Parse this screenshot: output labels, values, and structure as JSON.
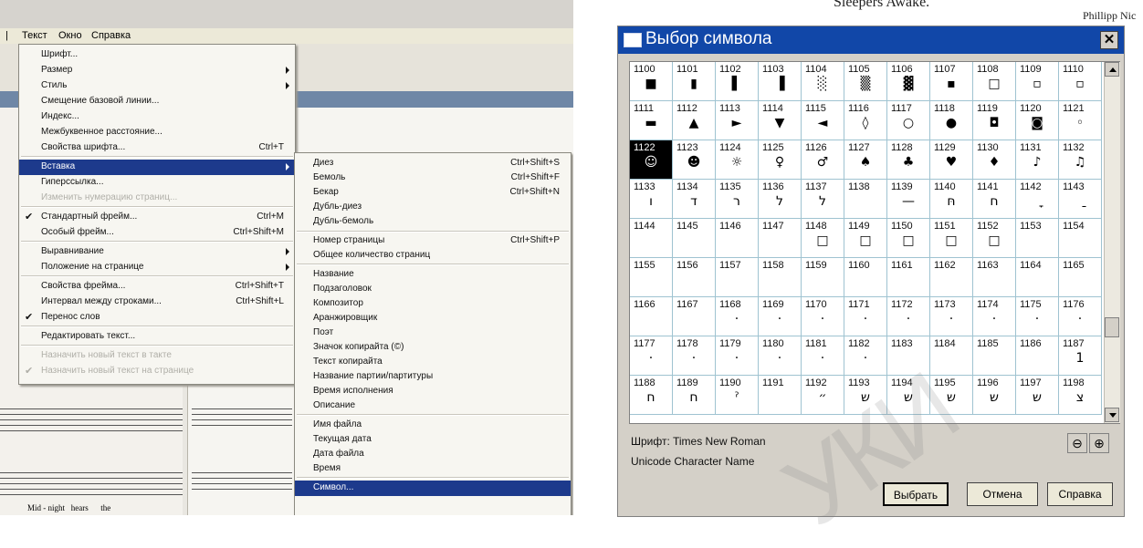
{
  "menubar": {
    "items": [
      "|",
      "Текст",
      "Окно",
      "Справка"
    ]
  },
  "text_menu": [
    {
      "label": "Шрифт...",
      "shortcut": "",
      "submenu": false,
      "state": "normal"
    },
    {
      "label": "Размер",
      "shortcut": "",
      "submenu": true,
      "state": "normal"
    },
    {
      "label": "Стиль",
      "shortcut": "",
      "submenu": true,
      "state": "normal"
    },
    {
      "label": "Смещение базовой линии...",
      "shortcut": "",
      "submenu": false,
      "state": "normal"
    },
    {
      "label": "Индекс...",
      "shortcut": "",
      "submenu": false,
      "state": "normal"
    },
    {
      "label": "Межбуквенное расстояние...",
      "shortcut": "",
      "submenu": false,
      "state": "normal"
    },
    {
      "label": "Свойства шрифта...",
      "shortcut": "Ctrl+T",
      "submenu": false,
      "state": "normal"
    },
    {
      "label": "Вставка",
      "shortcut": "",
      "submenu": true,
      "state": "highlighted"
    },
    {
      "label": "Гиперссылка...",
      "shortcut": "",
      "submenu": false,
      "state": "normal"
    },
    {
      "label": "Изменить нумерацию страниц...",
      "shortcut": "",
      "submenu": false,
      "state": "disabled"
    },
    {
      "label": "Стандартный фрейм...",
      "shortcut": "Ctrl+M",
      "submenu": false,
      "state": "checked"
    },
    {
      "label": "Особый фрейм...",
      "shortcut": "Ctrl+Shift+M",
      "submenu": false,
      "state": "normal"
    },
    {
      "label": "Выравнивание",
      "shortcut": "",
      "submenu": true,
      "state": "normal"
    },
    {
      "label": "Положение на странице",
      "shortcut": "",
      "submenu": true,
      "state": "normal"
    },
    {
      "label": "Свойства фрейма...",
      "shortcut": "Ctrl+Shift+T",
      "submenu": false,
      "state": "normal"
    },
    {
      "label": "Интервал между строками...",
      "shortcut": "Ctrl+Shift+L",
      "submenu": false,
      "state": "normal"
    },
    {
      "label": "Перенос слов",
      "shortcut": "",
      "submenu": false,
      "state": "checked"
    },
    {
      "label": "Редактировать текст...",
      "shortcut": "",
      "submenu": false,
      "state": "normal"
    },
    {
      "label": "Назначить новый текст в такте",
      "shortcut": "",
      "submenu": false,
      "state": "disabled"
    },
    {
      "label": "Назначить новый текст на странице",
      "shortcut": "",
      "submenu": false,
      "state": "disabled-checked"
    }
  ],
  "insert_menu": [
    {
      "label": "Диез",
      "shortcut": "Ctrl+Shift+S",
      "state": "normal"
    },
    {
      "label": "Бемоль",
      "shortcut": "Ctrl+Shift+F",
      "state": "normal"
    },
    {
      "label": "Бекар",
      "shortcut": "Ctrl+Shift+N",
      "state": "normal"
    },
    {
      "label": "Дубль-диез",
      "shortcut": "",
      "state": "normal"
    },
    {
      "label": "Дубль-бемоль",
      "shortcut": "",
      "state": "normal"
    },
    {
      "label": "Номер страницы",
      "shortcut": "Ctrl+Shift+P",
      "state": "normal"
    },
    {
      "label": "Общее количество страниц",
      "shortcut": "",
      "state": "normal"
    },
    {
      "label": "Название",
      "shortcut": "",
      "state": "normal"
    },
    {
      "label": "Подзаголовок",
      "shortcut": "",
      "state": "normal"
    },
    {
      "label": "Композитор",
      "shortcut": "",
      "state": "normal"
    },
    {
      "label": "Аранжировщик",
      "shortcut": "",
      "state": "normal"
    },
    {
      "label": "Поэт",
      "shortcut": "",
      "state": "normal"
    },
    {
      "label": "Значок копирайта (©)",
      "shortcut": "",
      "state": "normal"
    },
    {
      "label": "Текст копирайта",
      "shortcut": "",
      "state": "normal"
    },
    {
      "label": "Название партии/партитуры",
      "shortcut": "",
      "state": "normal"
    },
    {
      "label": "Время исполнения",
      "shortcut": "",
      "state": "normal"
    },
    {
      "label": "Описание",
      "shortcut": "",
      "state": "normal"
    },
    {
      "label": "Имя файла",
      "shortcut": "",
      "state": "normal"
    },
    {
      "label": "Текущая дата",
      "shortcut": "",
      "state": "normal"
    },
    {
      "label": "Дата файла",
      "shortcut": "",
      "state": "normal"
    },
    {
      "label": "Время",
      "shortcut": "",
      "state": "normal"
    },
    {
      "label": "Символ...",
      "shortcut": "",
      "state": "highlighted"
    }
  ],
  "score": {
    "lyrics": "Mid - night   hears      the"
  },
  "background_text": {
    "top_title": "Sleepers Awake.",
    "top_right": "Phillipp Nic"
  },
  "dialog": {
    "title": "Выбор символа",
    "close_label": "✕",
    "font_label": "Шрифт:",
    "font_name": "Times New Roman",
    "unicode_name_label": "Unicode Character Name",
    "zoom_out_icon": "zoom-out-icon",
    "zoom_in_icon": "zoom-in-icon",
    "buttons": {
      "select": "Выбрать",
      "cancel": "Отмена",
      "help": "Справка"
    },
    "selected": 1122,
    "cells": [
      {
        "n": "1100",
        "g": "■"
      },
      {
        "n": "1101",
        "g": "▮"
      },
      {
        "n": "1102",
        "g": "▌"
      },
      {
        "n": "1103",
        "g": "▐"
      },
      {
        "n": "1104",
        "g": "░"
      },
      {
        "n": "1105",
        "g": "▒"
      },
      {
        "n": "1106",
        "g": "▓"
      },
      {
        "n": "1107",
        "g": "▪"
      },
      {
        "n": "1108",
        "g": "□"
      },
      {
        "n": "1109",
        "g": "▫"
      },
      {
        "n": "1110",
        "g": "▫"
      },
      {
        "n": "1111",
        "g": "▬"
      },
      {
        "n": "1112",
        "g": "▲"
      },
      {
        "n": "1113",
        "g": "►"
      },
      {
        "n": "1114",
        "g": "▼"
      },
      {
        "n": "1115",
        "g": "◄"
      },
      {
        "n": "1116",
        "g": "◊"
      },
      {
        "n": "1117",
        "g": "○"
      },
      {
        "n": "1118",
        "g": "●"
      },
      {
        "n": "1119",
        "g": "◘"
      },
      {
        "n": "1120",
        "g": "◙"
      },
      {
        "n": "1121",
        "g": "◦"
      },
      {
        "n": "1122",
        "g": "☺"
      },
      {
        "n": "1123",
        "g": "☻"
      },
      {
        "n": "1124",
        "g": "☼"
      },
      {
        "n": "1125",
        "g": "♀"
      },
      {
        "n": "1126",
        "g": "♂"
      },
      {
        "n": "1127",
        "g": "♠"
      },
      {
        "n": "1128",
        "g": "♣"
      },
      {
        "n": "1129",
        "g": "♥"
      },
      {
        "n": "1130",
        "g": "♦"
      },
      {
        "n": "1131",
        "g": "♪"
      },
      {
        "n": "1132",
        "g": "♫"
      },
      {
        "n": "1133",
        "g": "ו"
      },
      {
        "n": "1134",
        "g": "ד"
      },
      {
        "n": "1135",
        "g": "ר"
      },
      {
        "n": "1136",
        "g": "ל"
      },
      {
        "n": "1137",
        "g": "ל"
      },
      {
        "n": "1138",
        "g": ""
      },
      {
        "n": "1139",
        "g": "—"
      },
      {
        "n": "1140",
        "g": "ּח"
      },
      {
        "n": "1141",
        "g": "ח"
      },
      {
        "n": "1142",
        "g": "ָ"
      },
      {
        "n": "1143",
        "g": "ַ"
      },
      {
        "n": "1144",
        "g": ""
      },
      {
        "n": "1145",
        "g": ""
      },
      {
        "n": "1146",
        "g": ""
      },
      {
        "n": "1147",
        "g": ""
      },
      {
        "n": "1148",
        "g": "□"
      },
      {
        "n": "1149",
        "g": "□"
      },
      {
        "n": "1150",
        "g": "□"
      },
      {
        "n": "1151",
        "g": "□"
      },
      {
        "n": "1152",
        "g": "□"
      },
      {
        "n": "1153",
        "g": ""
      },
      {
        "n": "1154",
        "g": ""
      },
      {
        "n": "1155",
        "g": ""
      },
      {
        "n": "1156",
        "g": ""
      },
      {
        "n": "1157",
        "g": ""
      },
      {
        "n": "1158",
        "g": ""
      },
      {
        "n": "1159",
        "g": ""
      },
      {
        "n": "1160",
        "g": ""
      },
      {
        "n": "1161",
        "g": ""
      },
      {
        "n": "1162",
        "g": ""
      },
      {
        "n": "1163",
        "g": ""
      },
      {
        "n": "1164",
        "g": ""
      },
      {
        "n": "1165",
        "g": ""
      },
      {
        "n": "1166",
        "g": ""
      },
      {
        "n": "1167",
        "g": ""
      },
      {
        "n": "1168",
        "g": "·"
      },
      {
        "n": "1169",
        "g": "·"
      },
      {
        "n": "1170",
        "g": "·"
      },
      {
        "n": "1171",
        "g": "·"
      },
      {
        "n": "1172",
        "g": "·"
      },
      {
        "n": "1173",
        "g": "·"
      },
      {
        "n": "1174",
        "g": "·"
      },
      {
        "n": "1175",
        "g": "·"
      },
      {
        "n": "1176",
        "g": "·"
      },
      {
        "n": "1177",
        "g": "·"
      },
      {
        "n": "1178",
        "g": "·"
      },
      {
        "n": "1179",
        "g": "·"
      },
      {
        "n": "1180",
        "g": "·"
      },
      {
        "n": "1181",
        "g": "·"
      },
      {
        "n": "1182",
        "g": "·"
      },
      {
        "n": "1183",
        "g": ""
      },
      {
        "n": "1184",
        "g": ""
      },
      {
        "n": "1185",
        "g": ""
      },
      {
        "n": "1186",
        "g": ""
      },
      {
        "n": "1187",
        "g": "1"
      },
      {
        "n": "1188",
        "g": "ח"
      },
      {
        "n": "1189",
        "g": "ח"
      },
      {
        "n": "1190",
        "g": "ˀ"
      },
      {
        "n": "1191",
        "g": ""
      },
      {
        "n": "1192",
        "g": "״"
      },
      {
        "n": "1193",
        "g": "ש"
      },
      {
        "n": "1194",
        "g": "ש"
      },
      {
        "n": "1195",
        "g": "ש"
      },
      {
        "n": "1196",
        "g": "ש"
      },
      {
        "n": "1197",
        "g": "ש"
      },
      {
        "n": "1198",
        "g": "צ"
      }
    ]
  },
  "watermark": "УКИ"
}
